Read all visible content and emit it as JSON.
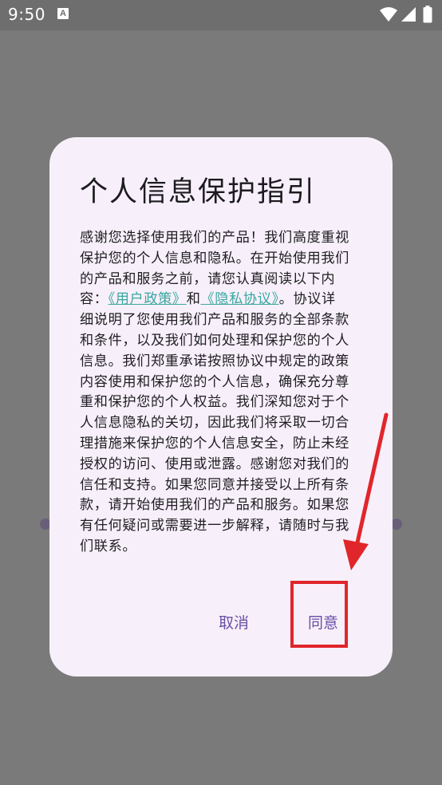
{
  "status_bar": {
    "time": "9:50",
    "notification_glyph": "A",
    "icons": [
      "wifi-icon",
      "signal-icon",
      "battery-icon"
    ]
  },
  "dialog": {
    "title": "个人信息保护指引",
    "body_part1": "感谢您选择使用我们的产品！我们高度重视保护您的个人信息和隐私。在开始使用我们的产品和服务之前，请您认真阅读以下内容：",
    "link_user_policy": "《用户政策》",
    "connector": "和",
    "link_privacy": "《隐私协议》",
    "body_part2": "。协议详细说明了您使用我们产品和服务的全部条款和条件，以及我们如何处理和保护您的个人信息。我们郑重承诺按照协议中规定的政策内容使用和保护您的个人信息，确保充分尊重和保护您的个人权益。我们深知您对于个人信息隐私的关切，因此我们将采取一切合理措施来保护您的个人信息安全，防止未经授权的访问、使用或泄露。感谢您对我们的信任和支持。如果您同意并接受以上所有条款，请开始使用我们的产品和服务。如果您有任何疑问或需要进一步解释，请随时与我们联系。",
    "cancel_label": "取消",
    "agree_label": "同意"
  },
  "colors": {
    "scrim": "#7a7a7a",
    "dialog_bg": "#f7f0fa",
    "button_text": "#6750a4",
    "link": "#3aa7a0",
    "annotation": "#e0262b"
  }
}
